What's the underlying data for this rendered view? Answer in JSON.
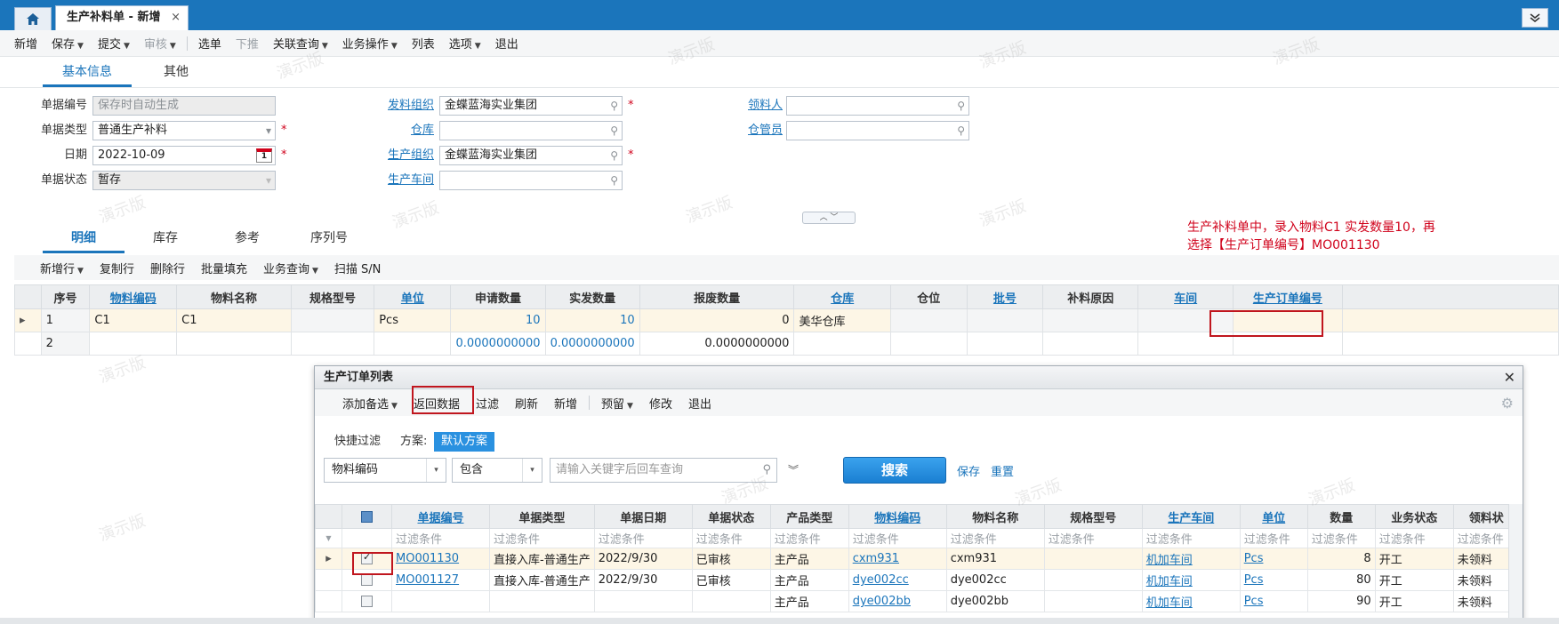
{
  "tabs": {
    "doc": "生产补料单 - 新增",
    "home_icon": "home-icon",
    "close": "×",
    "collapse": "≫"
  },
  "toolbar": [
    {
      "label": "新增",
      "caret": false,
      "disabled": false
    },
    {
      "label": "保存",
      "caret": true,
      "disabled": false
    },
    {
      "label": "提交",
      "caret": true,
      "disabled": false
    },
    {
      "label": "审核",
      "caret": true,
      "disabled": true
    },
    {
      "label": "选单",
      "caret": false,
      "disabled": false,
      "sep": true
    },
    {
      "label": "下推",
      "caret": false,
      "disabled": true
    },
    {
      "label": "关联查询",
      "caret": true,
      "disabled": false
    },
    {
      "label": "业务操作",
      "caret": true,
      "disabled": false
    },
    {
      "label": "列表",
      "caret": false,
      "disabled": false
    },
    {
      "label": "选项",
      "caret": true,
      "disabled": false
    },
    {
      "label": "退出",
      "caret": false,
      "disabled": false
    }
  ],
  "main_tabs": [
    "基本信息",
    "其他"
  ],
  "form": {
    "bill_no_label": "单据编号",
    "bill_no_value": "保存时自动生成",
    "bill_type_label": "单据类型",
    "bill_type_value": "普通生产补料",
    "date_label": "日期",
    "date_value": "2022-10-09",
    "status_label": "单据状态",
    "status_value": "暂存",
    "send_org_label": "发料组织",
    "send_org_value": "金蝶蓝海实业集团",
    "warehouse_label": "仓库",
    "warehouse_value": "",
    "prod_org_label": "生产组织",
    "prod_org_value": "金蝶蓝海实业集团",
    "workshop_label": "生产车间",
    "workshop_value": "",
    "picker_label": "领料人",
    "picker_value": "",
    "keeper_label": "仓管员",
    "keeper_value": "",
    "required": "*"
  },
  "annotation": {
    "line1": "生产补料单中，录入物料C1 实发数量10，再",
    "line2": "选择【生产订单编号】MO001130"
  },
  "detail_tabs": [
    "明细",
    "库存",
    "参考",
    "序列号"
  ],
  "detail_toolbar": [
    {
      "label": "新增行",
      "caret": true
    },
    {
      "label": "复制行",
      "caret": false
    },
    {
      "label": "删除行",
      "caret": false
    },
    {
      "label": "批量填充",
      "caret": false
    },
    {
      "label": "业务查询",
      "caret": true
    },
    {
      "label": "扫描 S/N",
      "caret": false
    }
  ],
  "detail_columns": [
    "序号",
    "物料编码",
    "物料名称",
    "规格型号",
    "单位",
    "申请数量",
    "实发数量",
    "报废数量",
    "仓库",
    "仓位",
    "批号",
    "补料原因",
    "车间",
    "生产订单编号"
  ],
  "detail_rows": [
    [
      "1",
      "C1",
      "C1",
      "",
      "Pcs",
      "10",
      "10",
      "0",
      "美华仓库",
      "",
      "",
      "",
      "",
      ""
    ],
    [
      "2",
      "",
      "",
      "",
      "",
      "0.0000000000",
      "0.0000000000",
      "0.0000000000",
      "",
      "",
      "",
      "",
      "",
      ""
    ]
  ],
  "dialog": {
    "title": "生产订单列表",
    "close": "✕",
    "toolbar": [
      {
        "label": "添加备选",
        "caret": true
      },
      {
        "label": "返回数据",
        "caret": false
      },
      {
        "label": "过滤",
        "caret": false
      },
      {
        "label": "刷新",
        "caret": false
      },
      {
        "label": "新增",
        "caret": false
      },
      {
        "label": "预留",
        "caret": true
      },
      {
        "label": "修改",
        "caret": false
      },
      {
        "label": "退出",
        "caret": false
      }
    ],
    "quick_filter_label": "快捷过滤",
    "scheme_label": "方案:",
    "scheme_value": "默认方案",
    "field_value": "物料编码",
    "op_value": "包含",
    "search_placeholder": "请输入关键字后回车查询",
    "search_button": "搜索",
    "save_link": "保存",
    "reset_link": "重置",
    "filter_placeholder": "过滤条件",
    "columns": [
      "单据编号",
      "单据类型",
      "单据日期",
      "单据状态",
      "产品类型",
      "物料编码",
      "物料名称",
      "规格型号",
      "生产车间",
      "单位",
      "数量",
      "业务状态",
      "领料状"
    ],
    "rows": [
      {
        "checked": true,
        "values": [
          "MO001130",
          "直接入库-普通生产",
          "2022/9/30",
          "已审核",
          "主产品",
          "cxm931",
          "cxm931",
          "",
          "机加车间",
          "Pcs",
          "8",
          "开工",
          "未领料"
        ]
      },
      {
        "checked": false,
        "values": [
          "MO001127",
          "直接入库-普通生产",
          "2022/9/30",
          "已审核",
          "主产品",
          "dye002cc",
          "dye002cc",
          "",
          "机加车间",
          "Pcs",
          "80",
          "开工",
          "未领料"
        ]
      },
      {
        "checked": false,
        "values": [
          "",
          "",
          "",
          "",
          "主产品",
          "dye002bb",
          "dye002bb",
          "",
          "机加车间",
          "Pcs",
          "90",
          "开工",
          "未领料"
        ]
      }
    ]
  },
  "watermark": "演示版",
  "colors": {
    "brand": "#1b75bb",
    "highlight": "#c0161e",
    "selected_row": "#fdf6e6"
  }
}
